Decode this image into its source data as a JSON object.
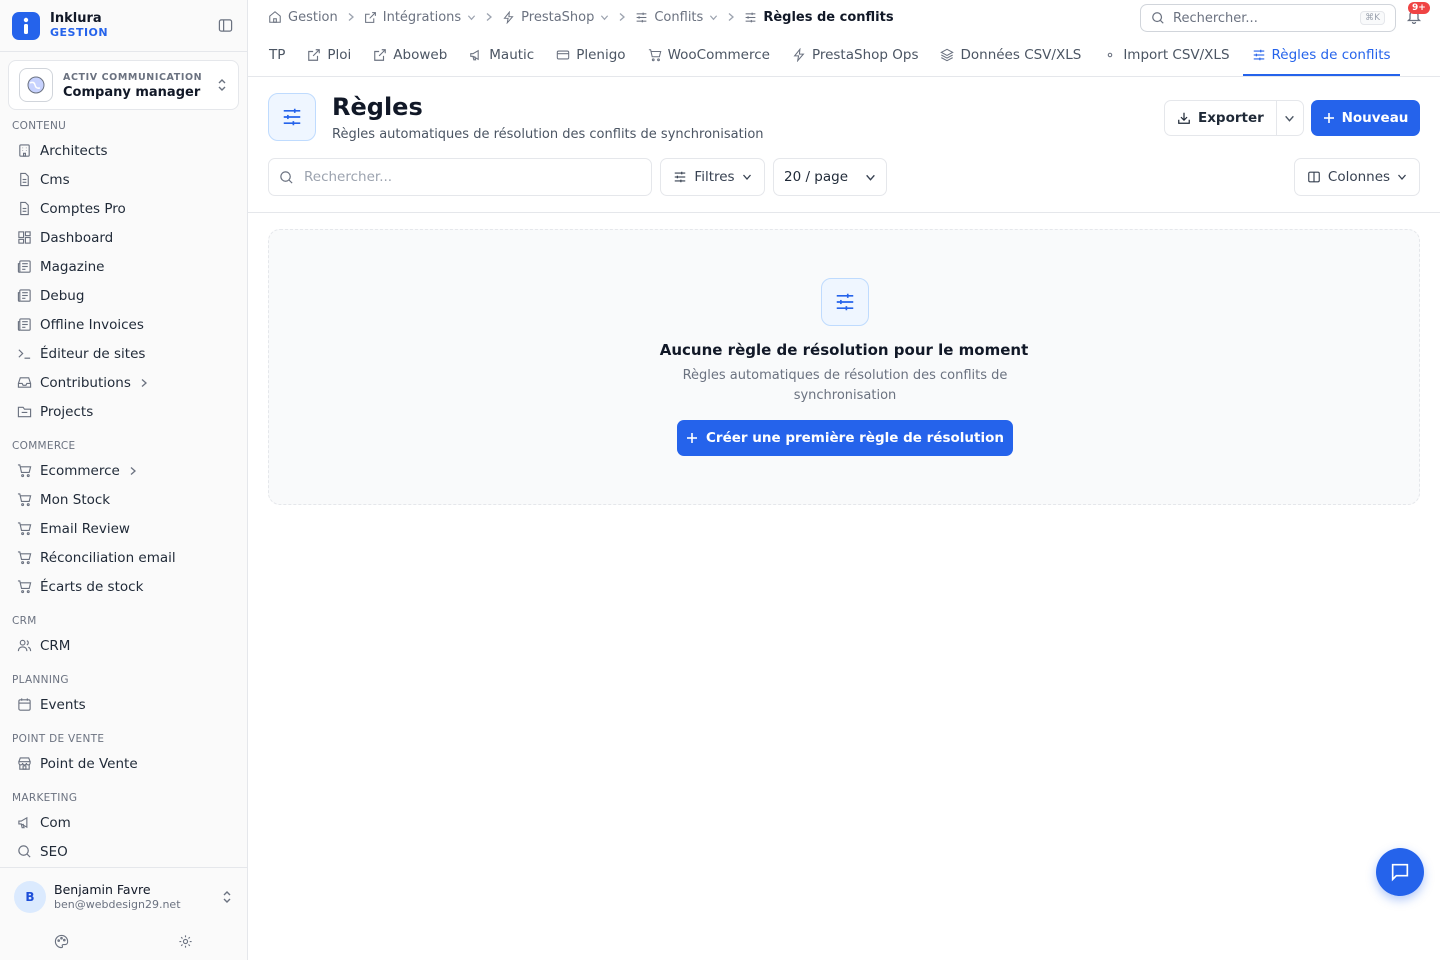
{
  "brand": {
    "name": "Inklura",
    "sub": "GESTION"
  },
  "org": {
    "label": "ACTIV COMMUNICATION",
    "name": "Company manager"
  },
  "sidebar": {
    "sections": [
      {
        "title": "CONTENU",
        "items": [
          {
            "label": "Architects",
            "icon": "building-icon"
          },
          {
            "label": "Cms",
            "icon": "file-icon"
          },
          {
            "label": "Comptes Pro",
            "icon": "file-icon"
          },
          {
            "label": "Dashboard",
            "icon": "grid-icon"
          },
          {
            "label": "Magazine",
            "icon": "newspaper-icon"
          },
          {
            "label": "Debug",
            "icon": "newspaper-icon"
          },
          {
            "label": "Offline Invoices",
            "icon": "newspaper-icon"
          },
          {
            "label": "Éditeur de sites",
            "icon": "terminal-icon"
          },
          {
            "label": "Contributions",
            "icon": "inbox-icon"
          },
          {
            "label": "Projects",
            "icon": "folder-icon"
          }
        ]
      },
      {
        "title": "COMMERCE",
        "items": [
          {
            "label": "Ecommerce",
            "icon": "cart-icon"
          },
          {
            "label": "Mon Stock",
            "icon": "cart-icon"
          },
          {
            "label": "Email Review",
            "icon": "cart-icon"
          },
          {
            "label": "Réconciliation email",
            "icon": "cart-icon"
          },
          {
            "label": "Écarts de stock",
            "icon": "cart-icon"
          }
        ]
      },
      {
        "title": "CRM",
        "items": [
          {
            "label": "CRM",
            "icon": "users-icon"
          }
        ]
      },
      {
        "title": "PLANNING",
        "items": [
          {
            "label": "Events",
            "icon": "calendar-icon"
          }
        ]
      },
      {
        "title": "POINT DE VENTE",
        "items": [
          {
            "label": "Point de Vente",
            "icon": "store-icon"
          }
        ]
      },
      {
        "title": "MARKETING",
        "items": [
          {
            "label": "Com",
            "icon": "megaphone-icon"
          },
          {
            "label": "SEO",
            "icon": "search-icon"
          }
        ]
      }
    ]
  },
  "user": {
    "initial": "B",
    "name": "Benjamin Favre",
    "email": "ben@webdesign29.net"
  },
  "breadcrumb": [
    {
      "label": "Gestion"
    },
    {
      "label": "Intégrations"
    },
    {
      "label": "PrestaShop"
    },
    {
      "label": "Conflits"
    },
    {
      "label": "Règles de conflits"
    }
  ],
  "search": {
    "placeholder": "Rechercher...",
    "shortcut": "⌘K"
  },
  "notifications": {
    "badge": "9+"
  },
  "tabs": [
    {
      "label": "TP"
    },
    {
      "label": "Ploi"
    },
    {
      "label": "Aboweb"
    },
    {
      "label": "Mautic"
    },
    {
      "label": "Plenigo"
    },
    {
      "label": "WooCommerce"
    },
    {
      "label": "PrestaShop Ops"
    },
    {
      "label": "Données CSV/XLS"
    },
    {
      "label": "Import CSV/XLS"
    },
    {
      "label": "Règles de conflits"
    }
  ],
  "page": {
    "title": "Règles",
    "subtitle": "Règles automatiques de résolution des conflits de synchronisation",
    "export_label": "Exporter",
    "new_label": "Nouveau"
  },
  "toolbar": {
    "search_placeholder": "Rechercher...",
    "filters_label": "Filtres",
    "per_page": "20 / page",
    "columns_label": "Colonnes"
  },
  "empty": {
    "title": "Aucune règle de résolution pour le moment",
    "description": "Règles automatiques de résolution des conflits de synchronisation",
    "cta": "Créer une première règle de résolution"
  },
  "colors": {
    "accent": "#2563eb",
    "badge": "#ef4444"
  }
}
